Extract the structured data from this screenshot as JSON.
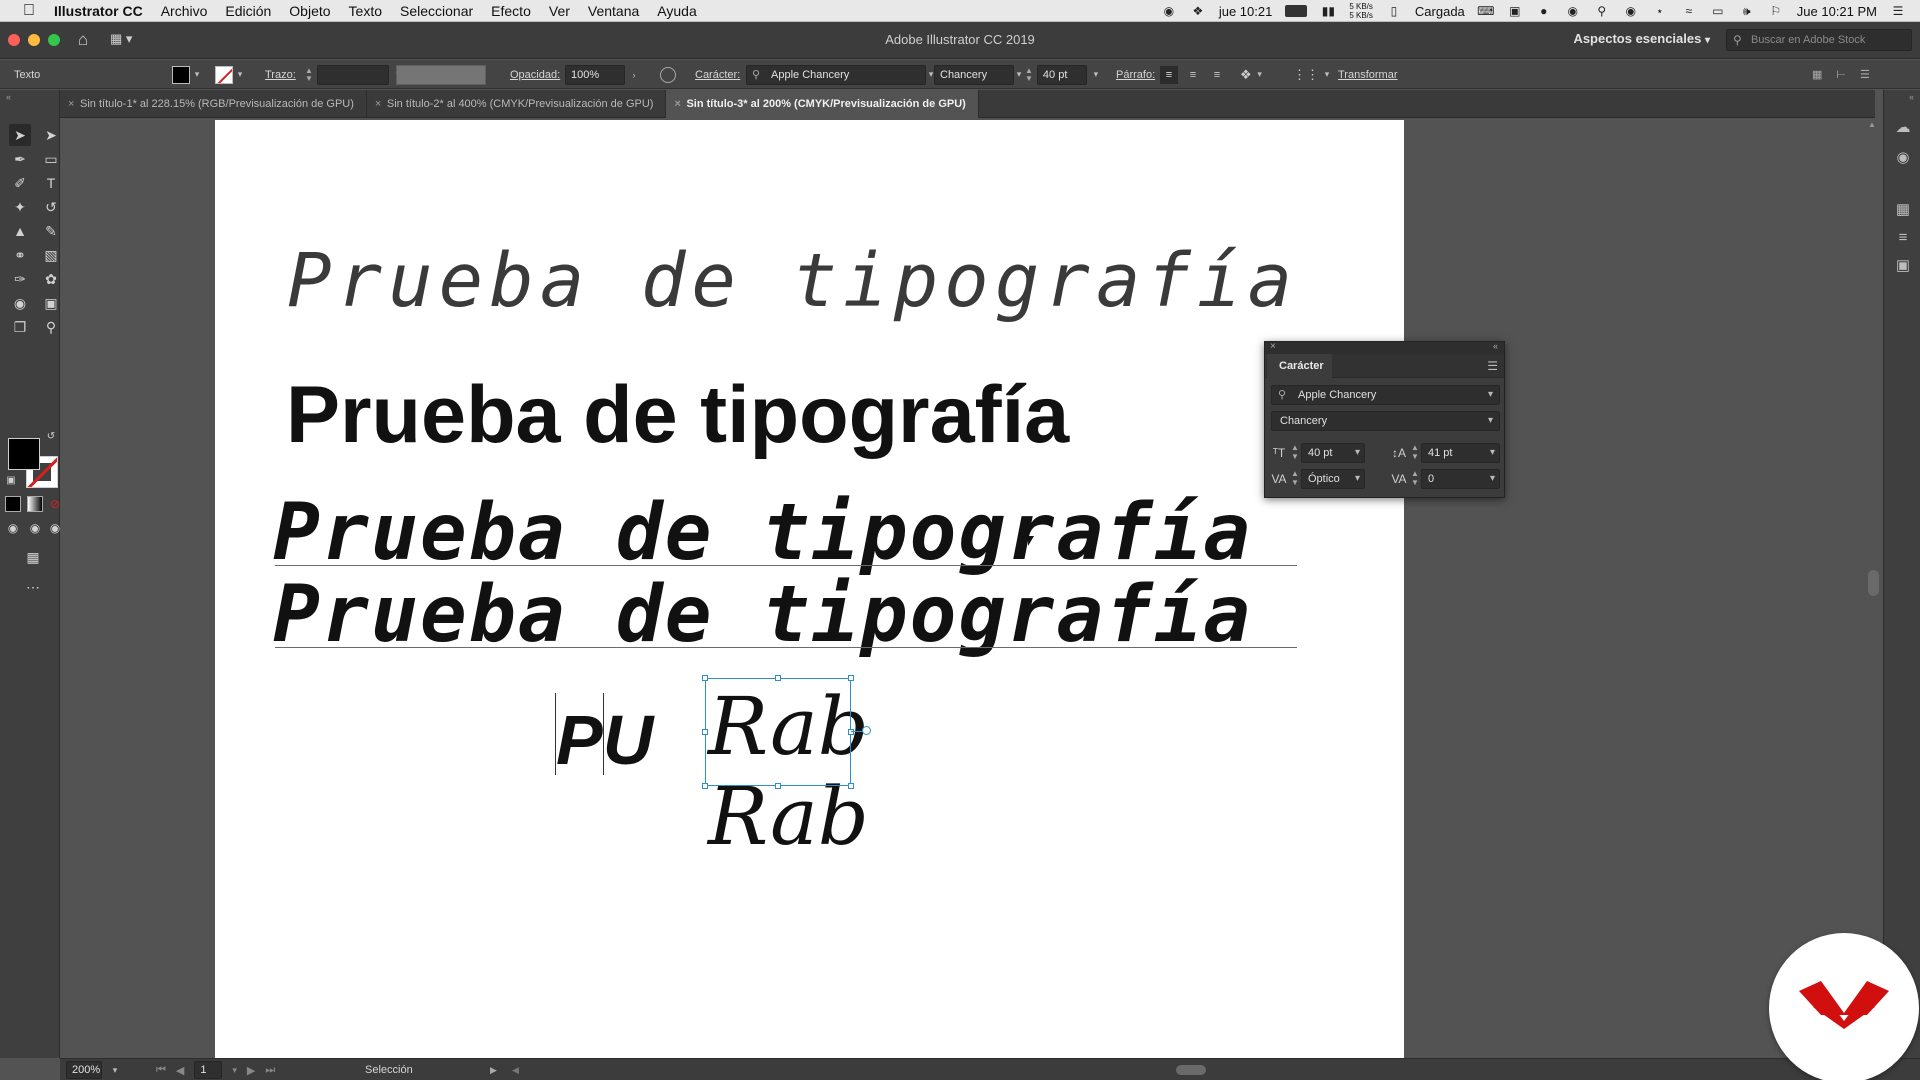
{
  "menubar": {
    "app_name": "Illustrator CC",
    "items": [
      "Archivo",
      "Edición",
      "Objeto",
      "Texto",
      "Seleccionar",
      "Efecto",
      "Ver",
      "Ventana",
      "Ayuda"
    ],
    "clock_short": "jue 10:21",
    "net_up": "5 KB/s",
    "net_down": "5 KB/s",
    "battery": "Cargada",
    "clock": "Jue 10:21 PM"
  },
  "window": {
    "title": "Adobe Illustrator CC 2019",
    "workspace": "Aspectos esenciales",
    "stock_placeholder": "Buscar en Adobe Stock"
  },
  "controlbar": {
    "mode_label": "Texto",
    "stroke_label": "Trazo:",
    "opacity_label": "Opacidad:",
    "opacity_value": "100%",
    "character_label": "Carácter:",
    "font_family": "Apple Chancery",
    "font_style": "Chancery",
    "font_size": "40 pt",
    "paragraph_label": "Párrafo:",
    "transform_label": "Transformar"
  },
  "tabs": [
    {
      "label": "Sin título-1* al 228.15% (RGB/Previsualización de GPU)",
      "active": false
    },
    {
      "label": "Sin título-2* al 400% (CMYK/Previsualización de GPU)",
      "active": false
    },
    {
      "label": "Sin título-3* al 200% (CMYK/Previsualización de GPU)",
      "active": true
    }
  ],
  "artboard": {
    "line1": "Prueba de tipografía",
    "line2": "Prueba de tipografía",
    "line3": "Prueba de tipografía",
    "line4": "Prueba de tipografía",
    "pu_text": "PU",
    "rab1": "Rab",
    "rab2": "Rab"
  },
  "char_panel": {
    "title": "Carácter",
    "font_family": "Apple Chancery",
    "font_style": "Chancery",
    "size": "40 pt",
    "leading": "41 pt",
    "kerning": "Óptico",
    "tracking": "0"
  },
  "statusbar": {
    "zoom": "200%",
    "artboard_num": "1",
    "tool_name": "Selección"
  },
  "colors": {
    "fill": "#000000",
    "stroke_none": "#d42020",
    "selection": "#2f8fc8",
    "brand": "#d10f0f"
  }
}
